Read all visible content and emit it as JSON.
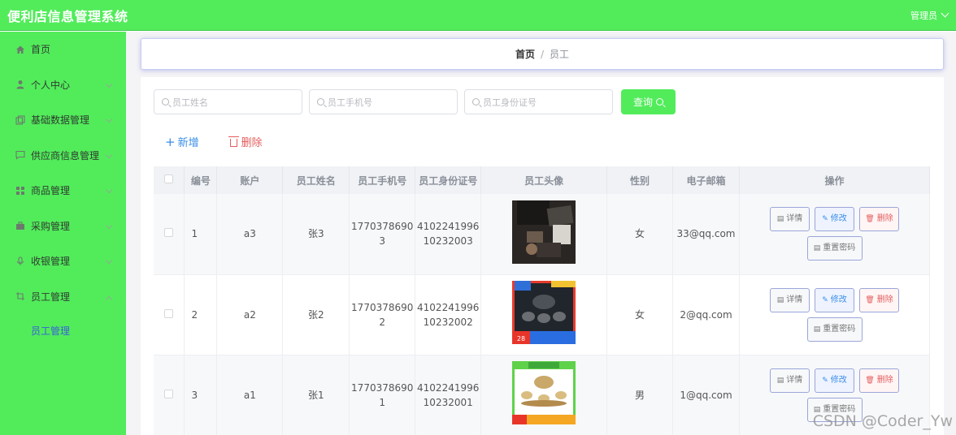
{
  "app": {
    "title": "便利店信息管理系统",
    "user": "管理员"
  },
  "sidebar": {
    "items": [
      {
        "label": "首页",
        "icon": "home-icon",
        "has_children": false
      },
      {
        "label": "个人中心",
        "icon": "user-icon",
        "has_children": true
      },
      {
        "label": "基础数据管理",
        "icon": "copy-icon",
        "has_children": true
      },
      {
        "label": "供应商信息管理",
        "icon": "chat-icon",
        "has_children": true
      },
      {
        "label": "商品管理",
        "icon": "grid-icon",
        "has_children": true
      },
      {
        "label": "采购管理",
        "icon": "briefcase-icon",
        "has_children": true
      },
      {
        "label": "收银管理",
        "icon": "mic-icon",
        "has_children": true
      },
      {
        "label": "员工管理",
        "icon": "crop-icon",
        "has_children": true,
        "expanded": true
      }
    ],
    "sub_item": "员工管理"
  },
  "breadcrumb": {
    "home": "首页",
    "separator": "/",
    "current": "员工"
  },
  "search": {
    "name_placeholder": "员工姓名",
    "phone_placeholder": "员工手机号",
    "idcard_placeholder": "员工身份证号",
    "query_label": "查询"
  },
  "actions": {
    "add_label": "新增",
    "delete_label": "删除"
  },
  "table": {
    "headers": [
      "编号",
      "账户",
      "员工姓名",
      "员工手机号",
      "员工身份证号",
      "员工头像",
      "性别",
      "电子邮箱",
      "操作"
    ],
    "rows": [
      {
        "id": "1",
        "account": "a3",
        "name": "张3",
        "phone_1": "1770378690",
        "phone_2": "3",
        "idcard_1": "4102241996",
        "idcard_2": "10232003",
        "gender": "女",
        "email": "33@qq.com",
        "avatar": "photo-dark"
      },
      {
        "id": "2",
        "account": "a2",
        "name": "张2",
        "phone_1": "1770378690",
        "phone_2": "2",
        "idcard_1": "4102241996",
        "idcard_2": "10232002",
        "gender": "女",
        "email": "2@qq.com",
        "avatar": "photo-teaset-red"
      },
      {
        "id": "3",
        "account": "a1",
        "name": "张1",
        "phone_1": "1770378690",
        "phone_2": "1",
        "idcard_1": "4102241996",
        "idcard_2": "10232001",
        "gender": "男",
        "email": "1@qq.com",
        "avatar": "photo-teaset-green"
      }
    ],
    "row_actions": {
      "detail": "详情",
      "edit": "修改",
      "remove": "删除",
      "reset": "重置密码"
    }
  },
  "watermark": "CSDN @Coder_Yw",
  "colors": {
    "primary": "#52ec5b",
    "link": "#3a8ee6",
    "danger": "#e55d5d",
    "submenu_active": "#3a60d8"
  }
}
